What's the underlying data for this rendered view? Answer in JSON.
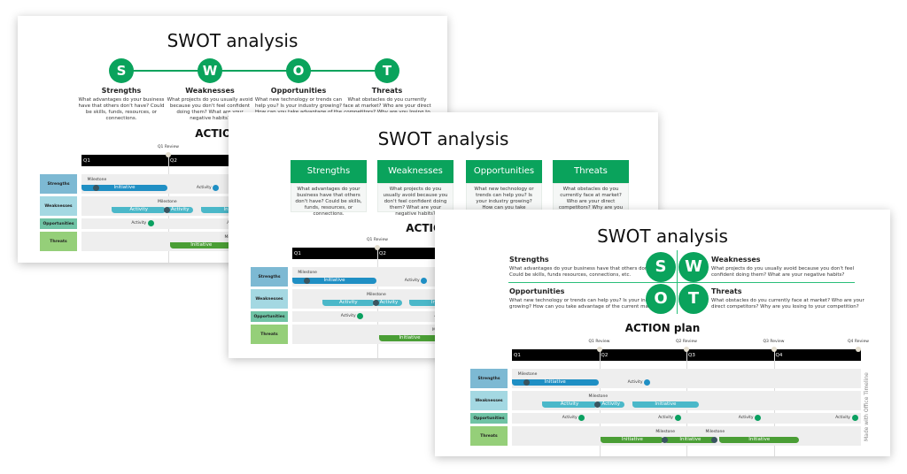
{
  "title": "SWOT analysis",
  "action_title": "ACTION plan",
  "swot": [
    {
      "letter": "S",
      "name": "Strengths",
      "desc": "What advantages do your business have that others don't have? Could be skills, funds, resources, or connections."
    },
    {
      "letter": "W",
      "name": "Weaknesses",
      "desc": "What projects do you usually avoid because you don't feel confident doing them? What are your negative habits?"
    },
    {
      "letter": "O",
      "name": "Opportunities",
      "desc": "What new technology or trends can help you? Is your industry growing? How can you take advantage of the current market?"
    },
    {
      "letter": "T",
      "name": "Threats",
      "desc": "What obstacles do you currently face at market? Who are your direct competitors? Why are you losing to your competition?"
    }
  ],
  "swot_quadrant_desc": [
    "What advantages do your business have that others don't have? Could be skills, funds resources, connections, etc.",
    "What projects do you usually avoid because you don't feel confident doing them? What are your negative habits?",
    "What new technology or trends can help you? Is your industry growing? How can you take advantage of the current market?",
    "What obstacles do you currently face at market? Who are your direct competitors? Why are you losing to your competition?"
  ],
  "colors": {
    "green": "#0aa35c"
  },
  "gantt": {
    "quarters": [
      "Q1",
      "Q2",
      "Q3",
      "Q4"
    ],
    "reviews": [
      {
        "label": "Q1 Review",
        "at": 1
      },
      {
        "label": "Q2 Review",
        "at": 2
      },
      {
        "label": "Q3 Review",
        "at": 3
      },
      {
        "label": "Q4 Review",
        "at": 4
      }
    ],
    "rows": [
      {
        "label": "Strengths",
        "label_color": "#7db9d3",
        "color": "#1f8fc4",
        "items": [
          {
            "type": "bar",
            "label": "Initiative",
            "start": 0,
            "end": 1
          },
          {
            "type": "milestone",
            "label": "Milestone",
            "at": 0.17
          },
          {
            "type": "activity",
            "label": "Activity",
            "at": 1.55
          }
        ]
      },
      {
        "label": "Weaknesses",
        "label_color": "#a4d8e2",
        "color": "#4bb8c9",
        "items": [
          {
            "type": "bar",
            "label": "Activity",
            "start": 0.35,
            "end": 0.98
          },
          {
            "type": "bar",
            "label": "Activity",
            "start": 0.98,
            "end": 1.3
          },
          {
            "type": "bar",
            "label": "Initiative",
            "start": 1.38,
            "end": 2.15
          },
          {
            "type": "milestone",
            "label": "Milestone",
            "at": 0.98
          }
        ]
      },
      {
        "label": "Opportunities",
        "label_color": "#6fc3a5",
        "color": "#0aa060",
        "items": [
          {
            "type": "activity",
            "label": "Activity",
            "at": 0.8
          },
          {
            "type": "activity",
            "label": "Activity",
            "at": 1.9
          },
          {
            "type": "activity",
            "label": "Activity",
            "at": 2.82
          },
          {
            "type": "activity",
            "label": "Activity",
            "at": 3.93
          }
        ]
      },
      {
        "label": "Threats",
        "label_color": "#95cf79",
        "color": "#4a9e35",
        "items": [
          {
            "type": "bar",
            "label": "Initiative",
            "start": 1.02,
            "end": 1.75
          },
          {
            "type": "bar",
            "label": "Initiative",
            "start": 1.75,
            "end": 2.35
          },
          {
            "type": "bar",
            "label": "Initiative",
            "start": 2.38,
            "end": 3.3
          },
          {
            "type": "milestone",
            "label": "Milestone",
            "at": 1.75
          },
          {
            "type": "milestone",
            "label": "Milestone",
            "at": 2.32
          }
        ]
      }
    ]
  },
  "brand": "Made with Office Timeline"
}
